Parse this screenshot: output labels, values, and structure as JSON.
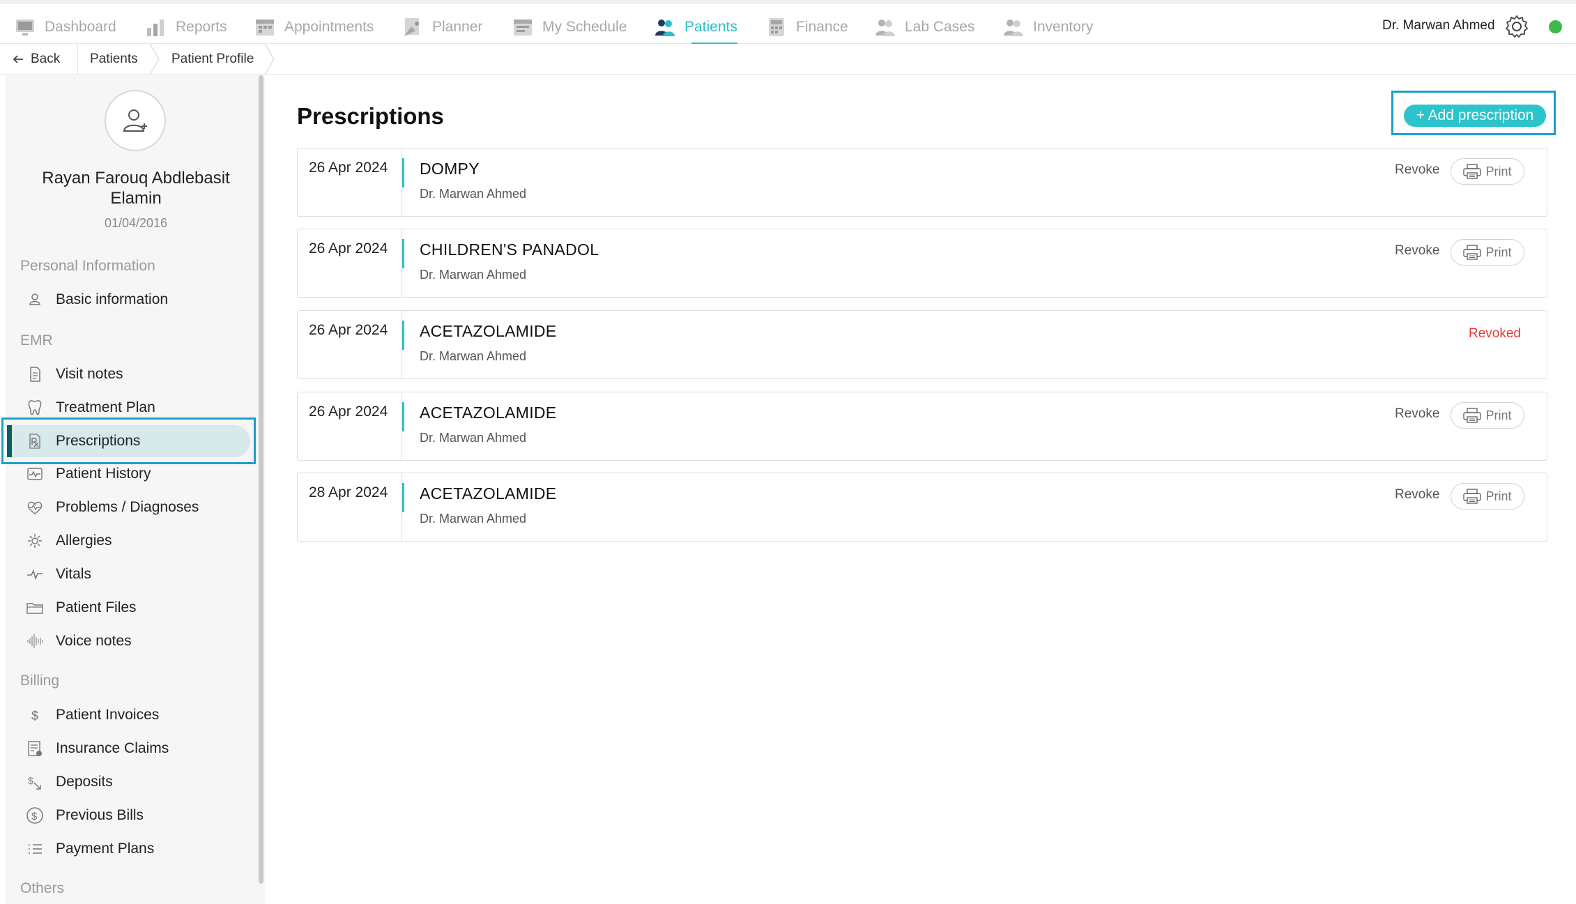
{
  "nav": {
    "items": [
      {
        "label": "Dashboard",
        "icon": "dashboard-icon",
        "active": false
      },
      {
        "label": "Reports",
        "icon": "reports-icon",
        "active": false
      },
      {
        "label": "Appointments",
        "icon": "appointments-icon",
        "active": false
      },
      {
        "label": "Planner",
        "icon": "planner-icon",
        "active": false
      },
      {
        "label": "My Schedule",
        "icon": "schedule-icon",
        "active": false
      },
      {
        "label": "Patients",
        "icon": "patients-icon",
        "active": true
      },
      {
        "label": "Finance",
        "icon": "finance-icon",
        "active": false
      },
      {
        "label": "Lab Cases",
        "icon": "lab-cases-icon",
        "active": false
      },
      {
        "label": "Inventory",
        "icon": "inventory-icon",
        "active": false
      }
    ],
    "user_name": "Dr. Marwan Ahmed",
    "accent_color": "#2bbfc6",
    "status_color": "#3fb94c"
  },
  "breadcrumb": {
    "back": "Back",
    "items": [
      "Patients",
      "Patient Profile"
    ]
  },
  "patient": {
    "name": "Rayan Farouq Abdlebasit Elamin",
    "dob": "01/04/2016"
  },
  "sidebar": {
    "sections": [
      {
        "title": "Personal Information",
        "items": [
          {
            "label": "Basic information",
            "icon": "user-icon"
          }
        ]
      },
      {
        "title": "EMR",
        "items": [
          {
            "label": "Visit notes",
            "icon": "document-icon"
          },
          {
            "label": "Treatment Plan",
            "icon": "tooth-icon"
          },
          {
            "label": "Prescriptions",
            "icon": "rx-icon",
            "active": true
          },
          {
            "label": "Patient History",
            "icon": "history-icon"
          },
          {
            "label": "Problems / Diagnoses",
            "icon": "diagnoses-icon"
          },
          {
            "label": "Allergies",
            "icon": "allergies-icon"
          },
          {
            "label": "Vitals",
            "icon": "vitals-icon"
          },
          {
            "label": "Patient Files",
            "icon": "folder-icon"
          },
          {
            "label": "Voice notes",
            "icon": "voice-icon"
          }
        ]
      },
      {
        "title": "Billing",
        "items": [
          {
            "label": "Patient Invoices",
            "icon": "dollar-icon"
          },
          {
            "label": "Insurance Claims",
            "icon": "claims-icon"
          },
          {
            "label": "Deposits",
            "icon": "deposits-icon"
          },
          {
            "label": "Previous Bills",
            "icon": "bills-icon"
          },
          {
            "label": "Payment Plans",
            "icon": "list-icon"
          }
        ]
      },
      {
        "title": "Others",
        "items": []
      }
    ]
  },
  "main": {
    "title": "Prescriptions",
    "add_button": "+ Add prescription",
    "revoke_label": "Revoke",
    "print_label": "Print",
    "revoked_label": "Revoked",
    "revoked_color": "#e53935",
    "prescriptions": [
      {
        "date": "26 Apr 2024",
        "drug": "DOMPY",
        "doctor": "Dr. Marwan Ahmed",
        "revoked": false
      },
      {
        "date": "26 Apr 2024",
        "drug": "CHILDREN'S PANADOL",
        "doctor": "Dr. Marwan Ahmed",
        "revoked": false
      },
      {
        "date": "26 Apr 2024",
        "drug": "ACETAZOLAMIDE",
        "doctor": "Dr. Marwan Ahmed",
        "revoked": true
      },
      {
        "date": "26 Apr 2024",
        "drug": "ACETAZOLAMIDE",
        "doctor": "Dr. Marwan Ahmed",
        "revoked": false
      },
      {
        "date": "28 Apr 2024",
        "drug": "ACETAZOLAMIDE",
        "doctor": "Dr. Marwan Ahmed",
        "revoked": false
      }
    ]
  }
}
